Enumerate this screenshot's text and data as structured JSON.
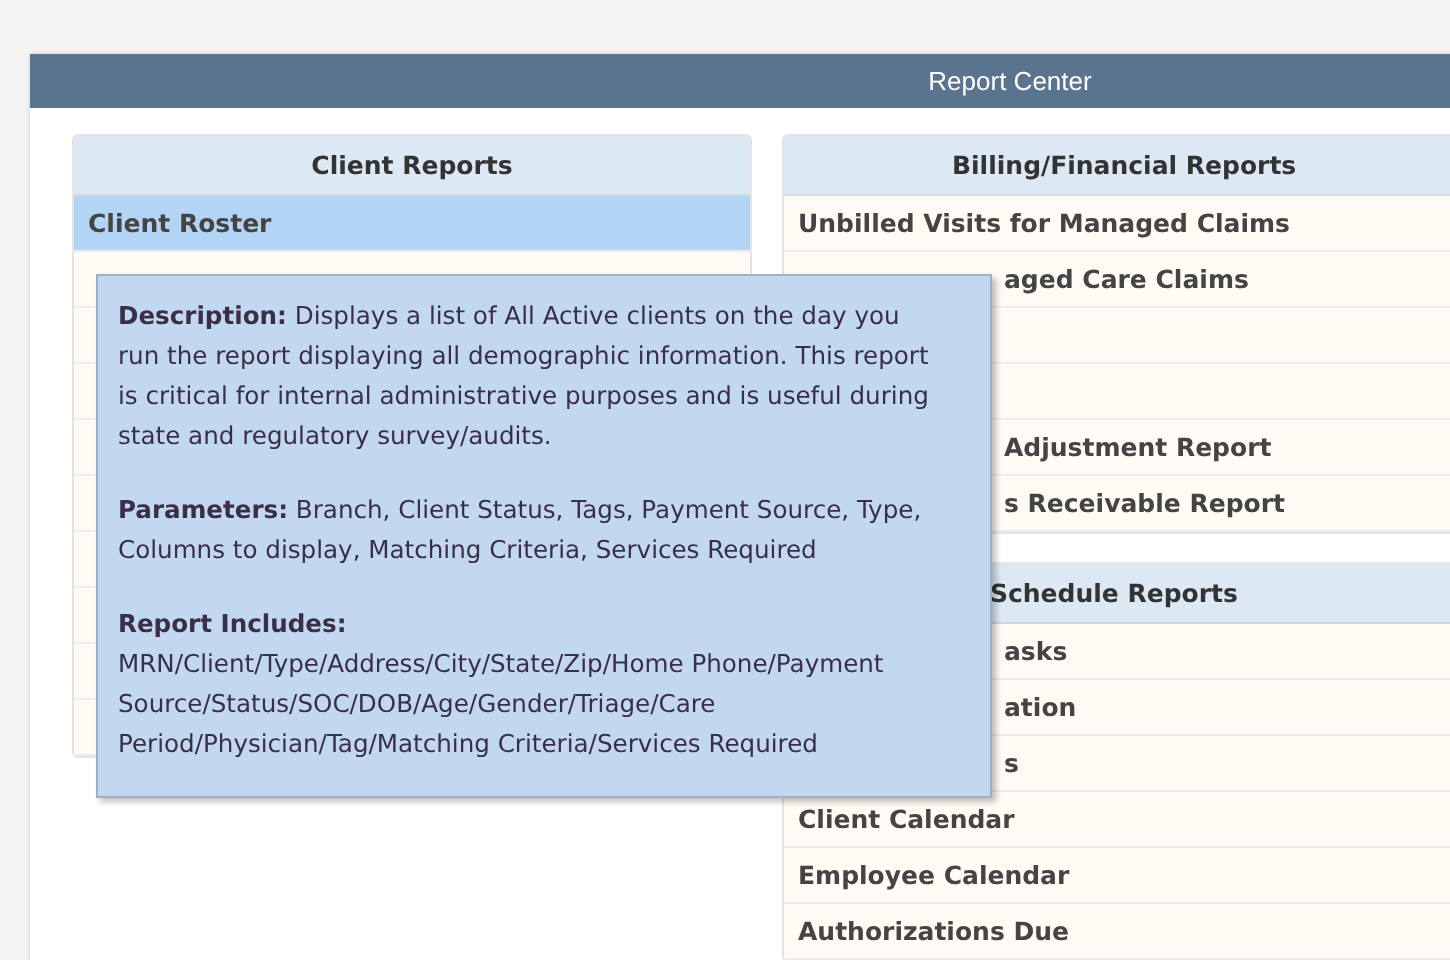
{
  "window": {
    "title": "Report Center"
  },
  "columns": [
    {
      "sections": [
        {
          "title": "Client Reports",
          "rows": [
            {
              "label": "Client Roster",
              "selected": true
            },
            {
              "selected": false
            },
            {
              "selected": false
            },
            {
              "selected": false
            },
            {
              "selected": false
            },
            {
              "selected": false
            },
            {
              "selected": false
            },
            {
              "selected": false
            },
            {
              "selected": false
            },
            {
              "selected": false
            }
          ]
        }
      ]
    },
    {
      "sections": [
        {
          "title": "Billing/Financial Reports",
          "rows": [
            {
              "label": "Unbilled Visits for Managed Claims",
              "selected": false
            },
            {
              "label": "aged Care Claims",
              "selected": false
            },
            {
              "selected": false
            },
            {
              "selected": false
            },
            {
              "label": "Adjustment Report",
              "selected": false
            },
            {
              "label": "s Receivable Report",
              "selected": false
            }
          ]
        },
        {
          "title": "Schedule Reports",
          "rows": [
            {
              "label": "asks",
              "selected": false
            },
            {
              "label": "ation",
              "selected": false
            },
            {
              "label": "s",
              "selected": false
            },
            {
              "label": "Client Calendar",
              "selected": false
            },
            {
              "label": "Employee Calendar",
              "selected": false
            },
            {
              "label": "Authorizations Due",
              "selected": false
            }
          ]
        }
      ]
    }
  ],
  "tooltip": {
    "paragraphs": [
      [
        "**Description:** Displays a list of All Active clients on the day you run the report displaying all demographic information. This report is critical for internal administrative purposes and is useful during state and regulatory survey/audits."
      ],
      [
        "**Parameters:** Branch, Client Status, Tags, Payment Source, Type, Columns to display, Matching Criteria, Services Required"
      ],
      [
        "Report Includes:",
        "MRN/Client/Type/Address/City/State/Zip/Home Phone/Payment Source/Status/SOC/DOB/Age/Gender/Triage/Care Period/Physician/Tag/Matching Criteria/Services Required"
      ]
    ]
  }
}
